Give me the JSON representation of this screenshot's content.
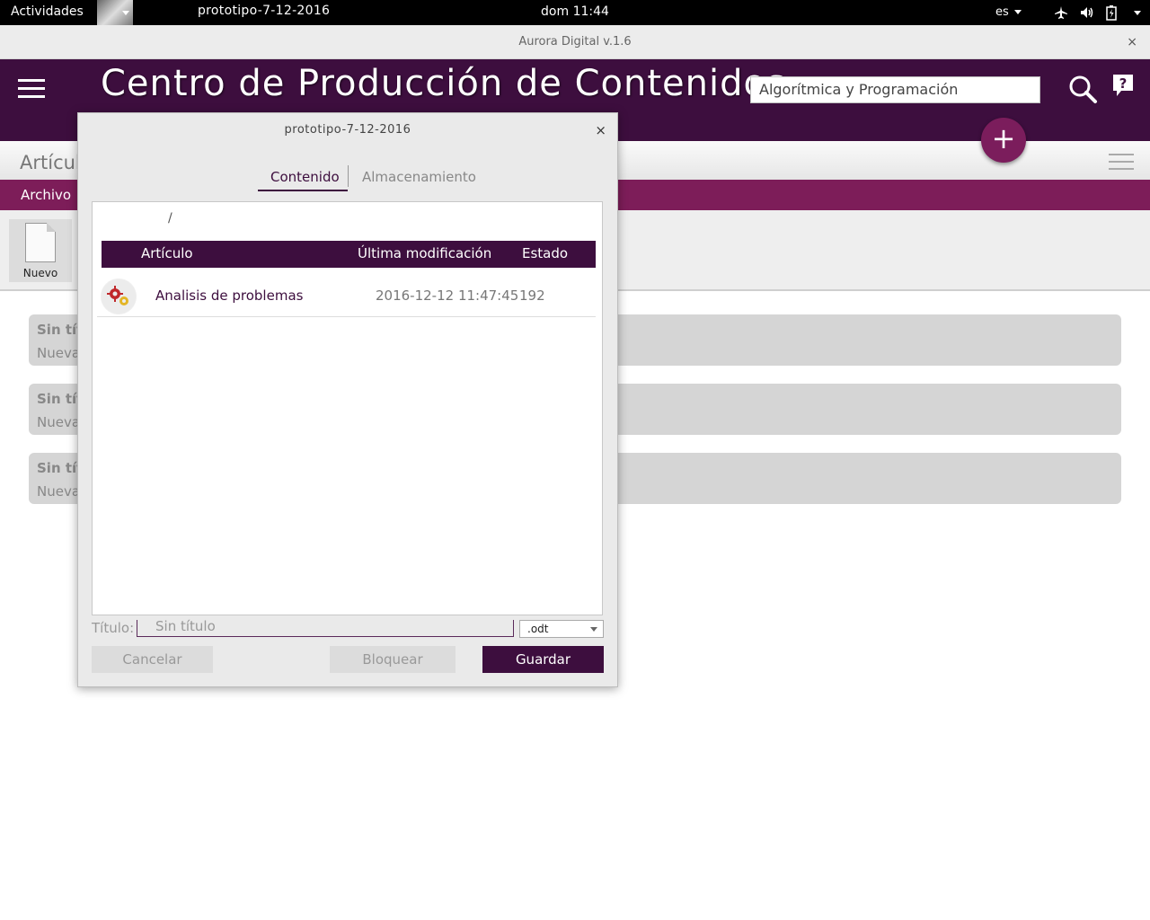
{
  "topbar": {
    "activities": "Actividades",
    "app_menu": "prototipo-7-12-2016",
    "clock": "dom 11:44",
    "language": "es",
    "tray_icons": [
      "airplane-icon",
      "volume-icon",
      "battery-icon",
      "power-menu-icon"
    ]
  },
  "window": {
    "title": "Aurora Digital v.1.6",
    "close": "×"
  },
  "header": {
    "title": "Centro de Producción de Contenidos",
    "search_value": "Algorítmica y Programación",
    "fab": "+"
  },
  "subheader": {
    "section_title": "Artículos"
  },
  "menubar": {
    "items": [
      "Archivo"
    ]
  },
  "toolbar": {
    "new_label": "Nuevo"
  },
  "cards": [
    {
      "title": "Sin título",
      "subtitle": "Nueva"
    },
    {
      "title": "Sin título",
      "subtitle": "Nueva"
    },
    {
      "title": "Sin título",
      "subtitle": "Nueva"
    }
  ],
  "dialog": {
    "title": "prototipo-7-12-2016",
    "close": "×",
    "tabs": [
      "Contenido",
      "Almacenamiento"
    ],
    "path": "/",
    "columns": [
      "Artículo",
      "Última modificación",
      "Estado"
    ],
    "rows": [
      {
        "name": "Analisis de problemas",
        "modified": "2016-12-12 11:47:45",
        "state": "192"
      }
    ],
    "title_label": "Título:",
    "title_placeholder": "Sin título",
    "extension": ".odt",
    "buttons": {
      "cancel": "Cancelar",
      "lock": "Bloquear",
      "save": "Guardar"
    }
  },
  "colors": {
    "header_bg": "#3d0e3e",
    "menubar_bg": "#7d1d59",
    "accent": "#7b1d5c"
  }
}
